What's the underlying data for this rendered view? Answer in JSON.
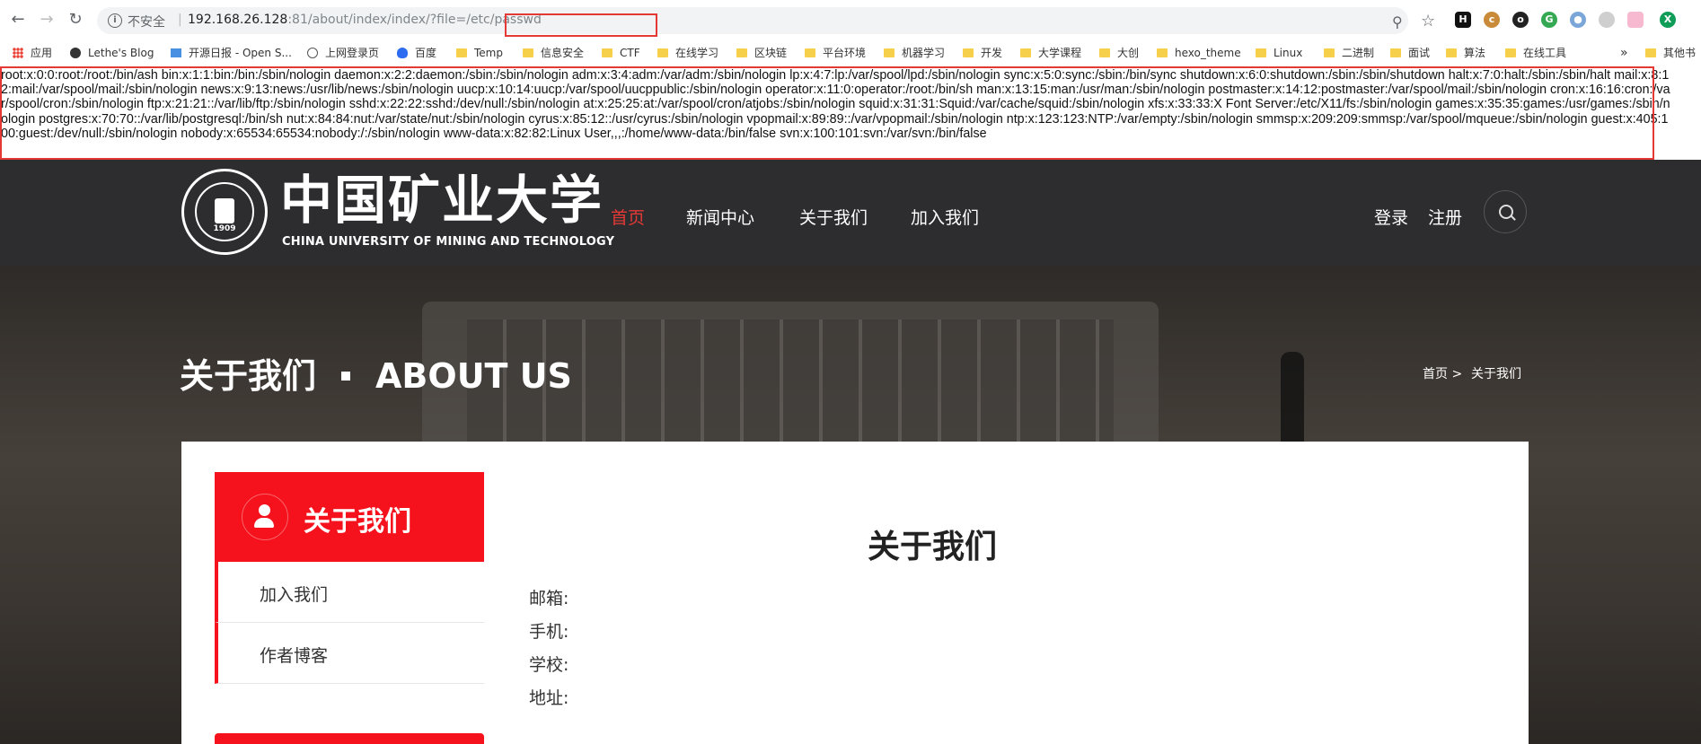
{
  "browser": {
    "insecure_label": "不安全",
    "url_host": "192.168.26.128",
    "url_port": ":81",
    "url_path": "/about/index/index",
    "url_query": "/?file=/etc/passwd",
    "bookmarks": [
      "应用",
      "Lethe's Blog",
      "开源日报 - Open S...",
      "上网登录页",
      "百度",
      "Temp",
      "信息安全",
      "CTF",
      "在线学习",
      "区块链",
      "平台环境",
      "机器学习",
      "开发",
      "大学课程",
      "大创",
      "hexo_theme",
      "Linux",
      "二进制",
      "面试",
      "算法",
      "在线工具"
    ],
    "other_bookmarks": "其他书",
    "more": "»"
  },
  "passwd_output": "root:x:0:0:root:/root:/bin/ash bin:x:1:1:bin:/bin:/sbin/nologin daemon:x:2:2:daemon:/sbin:/sbin/nologin adm:x:3:4:adm:/var/adm:/sbin/nologin lp:x:4:7:lp:/var/spool/lpd:/sbin/nologin sync:x:5:0:sync:/sbin:/bin/sync shutdown:x:6:0:shutdown:/sbin:/sbin/shutdown halt:x:7:0:halt:/sbin:/sbin/halt mail:x:8:12:mail:/var/spool/mail:/sbin/nologin news:x:9:13:news:/usr/lib/news:/sbin/nologin uucp:x:10:14:uucp:/var/spool/uucppublic:/sbin/nologin operator:x:11:0:operator:/root:/bin/sh man:x:13:15:man:/usr/man:/sbin/nologin postmaster:x:14:12:postmaster:/var/spool/mail:/sbin/nologin cron:x:16:16:cron:/var/spool/cron:/sbin/nologin ftp:x:21:21::/var/lib/ftp:/sbin/nologin sshd:x:22:22:sshd:/dev/null:/sbin/nologin at:x:25:25:at:/var/spool/cron/atjobs:/sbin/nologin squid:x:31:31:Squid:/var/cache/squid:/sbin/nologin xfs:x:33:33:X Font Server:/etc/X11/fs:/sbin/nologin games:x:35:35:games:/usr/games:/sbin/nologin postgres:x:70:70::/var/lib/postgresql:/bin/sh nut:x:84:84:nut:/var/state/nut:/sbin/nologin cyrus:x:85:12::/usr/cyrus:/sbin/nologin vpopmail:x:89:89::/var/vpopmail:/sbin/nologin ntp:x:123:123:NTP:/var/empty:/sbin/nologin smmsp:x:209:209:smmsp:/var/spool/mqueue:/sbin/nologin guest:x:405:100:guest:/dev/null:/sbin/nologin nobody:x:65534:65534:nobody:/:/sbin/nologin www-data:x:82:82:Linux User,,,:/home/www-data:/bin/false svn:x:100:101:svn:/var/svn:/bin/false",
  "site": {
    "logo_cn": "中国矿业大学",
    "logo_en": "CHINA UNIVERSITY OF MINING AND TECHNOLOGY",
    "logo_year": "1909",
    "nav": [
      "首页",
      "新闻中心",
      "关于我们",
      "加入我们"
    ],
    "login": "登录",
    "register": "注册"
  },
  "banner": {
    "title_cn": "关于我们",
    "title_en": "ABOUT US",
    "crumb_home": "首页 >",
    "crumb_current": "关于我们"
  },
  "sidebar": {
    "title": "关于我们",
    "items": [
      "加入我们",
      "作者博客"
    ]
  },
  "main": {
    "title": "关于我们",
    "fields": [
      "邮箱:",
      "手机:",
      "学校:",
      "地址:"
    ]
  },
  "colors": {
    "accent": "#f5121c",
    "highlight_box": "#e53935",
    "header_bg": "#2d2d30"
  }
}
